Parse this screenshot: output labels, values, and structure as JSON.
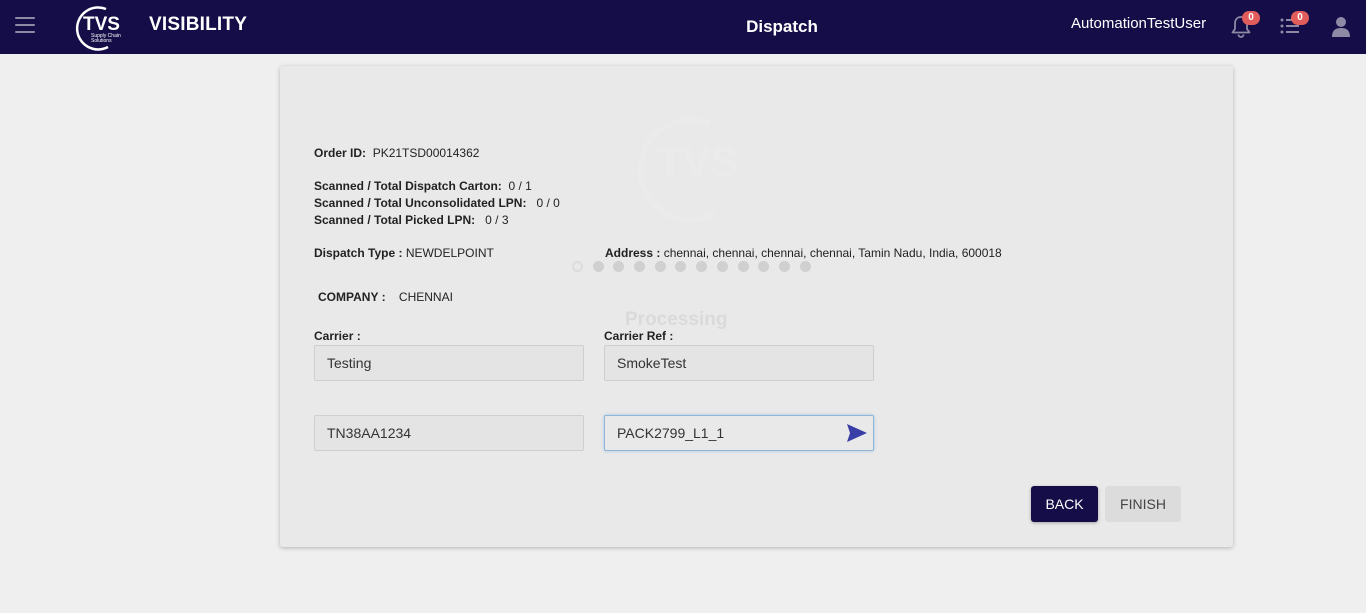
{
  "header": {
    "brand": "VISIBILITY",
    "logo_text": "TVS",
    "logo_sub1": "Supply Chain",
    "logo_sub2": "Solutions",
    "title": "Dispatch",
    "username": "AutomationTestUser",
    "notifications_count": "0",
    "tasks_count": "0"
  },
  "loader": {
    "text": "Processing",
    "watermark": "TVS"
  },
  "order": {
    "order_id_label": "Order ID:",
    "order_id": "PK21TSD00014362",
    "carton_label": "Scanned / Total Dispatch Carton:",
    "carton_value": "0 / 1",
    "unconsolidated_label": "Scanned / Total Unconsolidated LPN:",
    "unconsolidated_value": "0 / 0",
    "picked_label": "Scanned / Total Picked LPN:",
    "picked_value": "0 / 3",
    "dispatch_type_label": "Dispatch Type :",
    "dispatch_type": "NEWDELPOINT",
    "address_label": "Address :",
    "address": "chennai, chennai, chennai, chennai, Tamin Nadu, India, 600018",
    "company_label": "COMPANY :",
    "company": "CHENNAI"
  },
  "form": {
    "carrier_label": "Carrier :",
    "carrier_value": "Testing",
    "carrier_ref_label": "Carrier Ref :",
    "carrier_ref_value": "SmokeTest",
    "vehicle_value": "TN38AA1234",
    "scan_value": "PACK2799_L1_1"
  },
  "actions": {
    "back_label": "BACK",
    "finish_label": "FINISH"
  },
  "colors": {
    "header_bg": "#150d47",
    "badge": "#e25c5c",
    "primary_button": "#150d47",
    "send_icon": "#3a3fa8"
  }
}
